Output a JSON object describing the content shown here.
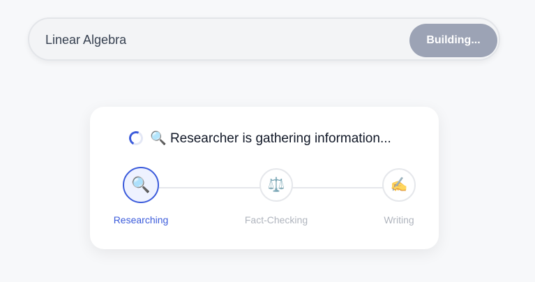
{
  "search": {
    "value": "Linear Algebra",
    "button_label": "Building..."
  },
  "progress": {
    "status_icon": "🔍",
    "status_text": "Researcher is gathering information...",
    "steps": [
      {
        "label": "Researching",
        "icon": "🔍",
        "icon_name": "magnifier-icon",
        "state": "active"
      },
      {
        "label": "Fact-Checking",
        "icon": "⚖️",
        "icon_name": "scales-icon",
        "state": "pending"
      },
      {
        "label": "Writing",
        "icon": "✍️",
        "icon_name": "writing-hand-icon",
        "state": "pending"
      }
    ]
  },
  "colors": {
    "accent": "#3b5bdb",
    "button_disabled": "#9ca3b5",
    "background": "#f7f8fa"
  }
}
